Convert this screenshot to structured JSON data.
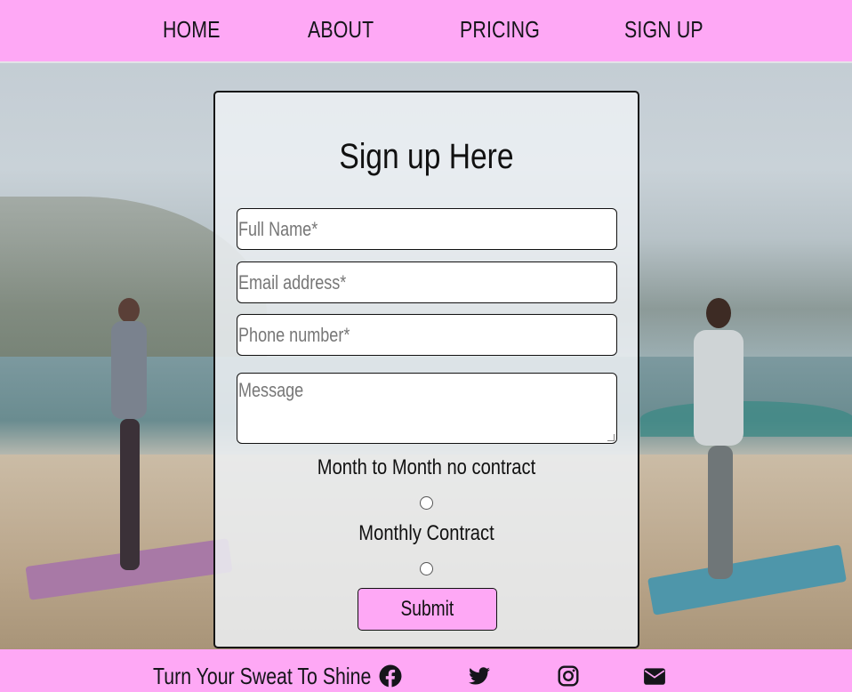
{
  "nav": {
    "items": [
      "HOME",
      "ABOUT",
      "PRICING",
      "SIGN UP"
    ]
  },
  "form": {
    "title": "Sign up Here",
    "full_name_placeholder": "Full Name*",
    "email_placeholder": "Email address*",
    "phone_placeholder": "Phone number*",
    "message_placeholder": "Message",
    "option_1": "Month to Month no contract",
    "option_2": "Monthly Contract",
    "submit_label": "Submit"
  },
  "footer": {
    "tagline": "Turn Your Sweat To Shine",
    "social_icons": [
      "facebook-icon",
      "twitter-icon",
      "instagram-icon",
      "envelope-icon"
    ]
  },
  "colors": {
    "accent": "#fea8f5",
    "text": "#15151a"
  }
}
